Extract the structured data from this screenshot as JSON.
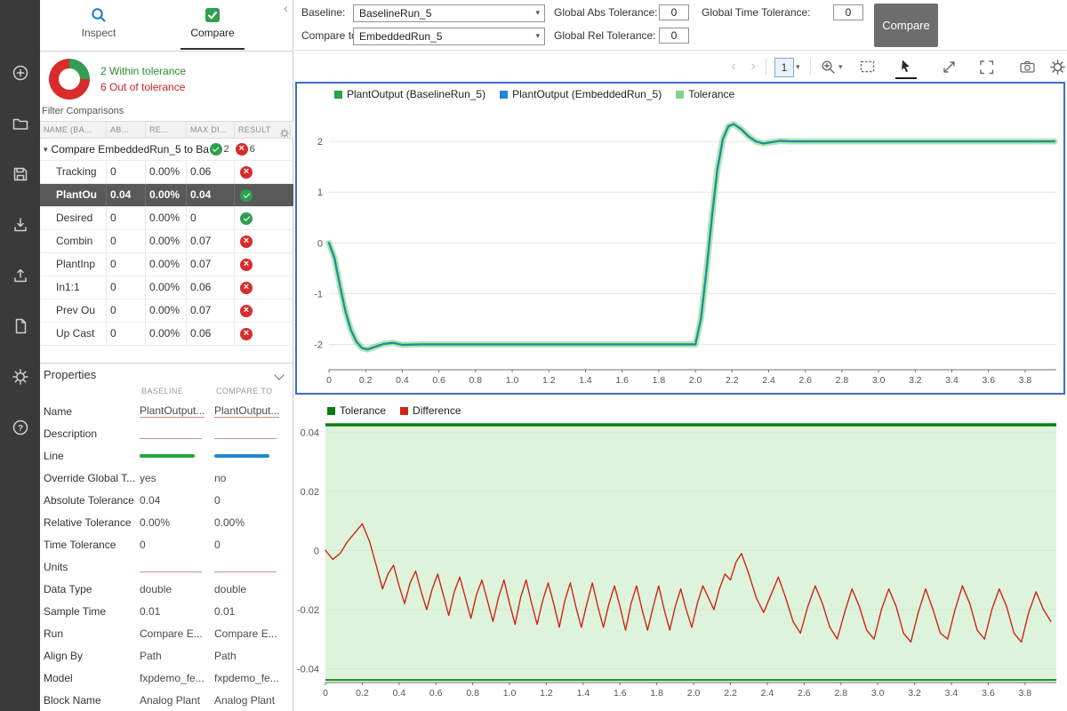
{
  "ui": {
    "tabs": {
      "inspect": "Inspect",
      "compare": "Compare"
    },
    "collapse_glyph": "‹"
  },
  "summary": {
    "within": "2 Within tolerance",
    "out": "6 Out of tolerance"
  },
  "filter_label": "Filter Comparisons",
  "rail_icons": [
    "add",
    "open",
    "save",
    "import",
    "export",
    "create-report",
    "preferences",
    "help"
  ],
  "toolbar2_icons": [
    "back",
    "forward",
    "subplot-layout",
    "zoom-in",
    "fit-to-view",
    "pointer",
    "expand",
    "fullscreen",
    "snapshot",
    "plot-settings"
  ],
  "comparisons": {
    "columns": [
      "NAME (BA...",
      "AB...",
      "RE...",
      "MAX DI...",
      "RESULT"
    ],
    "group": {
      "label": "Compare EmbeddedRun_5 to Ba...",
      "pass_count": "2",
      "fail_count": "6"
    },
    "rows": [
      {
        "name": "Tracking",
        "abs": "0",
        "rel": "0.00%",
        "max": "0.06",
        "result": "fail",
        "selected": false
      },
      {
        "name": "PlantOu",
        "abs": "0.04",
        "rel": "0.00%",
        "max": "0.04",
        "result": "pass",
        "selected": true
      },
      {
        "name": "Desired",
        "abs": "0",
        "rel": "0.00%",
        "max": "0",
        "result": "pass",
        "selected": false
      },
      {
        "name": "Combin",
        "abs": "0",
        "rel": "0.00%",
        "max": "0.07",
        "result": "fail",
        "selected": false
      },
      {
        "name": "PlantInp",
        "abs": "0",
        "rel": "0.00%",
        "max": "0.07",
        "result": "fail",
        "selected": false
      },
      {
        "name": "In1:1",
        "abs": "0",
        "rel": "0.00%",
        "max": "0.06",
        "result": "fail",
        "selected": false
      },
      {
        "name": "Prev Ou",
        "abs": "0",
        "rel": "0.00%",
        "max": "0.07",
        "result": "fail",
        "selected": false
      },
      {
        "name": "Up Cast",
        "abs": "0",
        "rel": "0.00%",
        "max": "0.06",
        "result": "fail",
        "selected": false
      }
    ]
  },
  "properties": {
    "title": "Properties",
    "columns": [
      "BASELINE",
      "COMPARE TO"
    ],
    "line_colors": {
      "baseline": "#27a244",
      "compare": "#1e88d2"
    },
    "rows": [
      {
        "label": "Name",
        "baseline": "PlantOutput...",
        "compare": "PlantOutput...",
        "type": "text",
        "editable": true
      },
      {
        "label": "Description",
        "baseline": "",
        "compare": "",
        "type": "text",
        "editable": true
      },
      {
        "label": "Line",
        "baseline": "",
        "compare": "",
        "type": "line",
        "editable": false
      },
      {
        "label": "Override Global T...",
        "baseline": "yes",
        "compare": "no",
        "type": "text",
        "editable": false
      },
      {
        "label": "Absolute Tolerance",
        "baseline": "0.04",
        "compare": "0",
        "type": "text",
        "editable": false
      },
      {
        "label": "Relative Tolerance",
        "baseline": "0.00%",
        "compare": "0.00%",
        "type": "text",
        "editable": false
      },
      {
        "label": "Time Tolerance",
        "baseline": "0",
        "compare": "0",
        "type": "text",
        "editable": false
      },
      {
        "label": "Units",
        "baseline": "",
        "compare": "",
        "type": "text",
        "editable": true
      },
      {
        "label": "Data Type",
        "baseline": "double",
        "compare": "double",
        "type": "text",
        "editable": false
      },
      {
        "label": "Sample Time",
        "baseline": "0.01",
        "compare": "0.01",
        "type": "text",
        "editable": false
      },
      {
        "label": "Run",
        "baseline": "Compare E...",
        "compare": "Compare E...",
        "type": "text",
        "editable": false
      },
      {
        "label": "Align By",
        "baseline": "Path",
        "compare": "Path",
        "type": "text",
        "editable": false
      },
      {
        "label": "Model",
        "baseline": "fxpdemo_fe...",
        "compare": "fxpdemo_fe...",
        "type": "text",
        "editable": false
      },
      {
        "label": "Block Name",
        "baseline": "Analog Plant",
        "compare": "Analog Plant",
        "type": "text",
        "editable": false
      }
    ]
  },
  "topbar": {
    "baseline_label": "Baseline:",
    "baseline_value": "BaselineRun_5",
    "compare_label": "Compare to:",
    "compare_value": "EmbeddedRun_5",
    "abs_label": "Global Abs Tolerance:",
    "abs_value": "0",
    "rel_label": "Global Rel Tolerance:",
    "rel_value": "0",
    "time_label": "Global Time Tolerance:",
    "time_value": "0",
    "compare_button": "Compare"
  },
  "toolbar": {
    "layout_value": "1"
  },
  "colors": {
    "selection_blue": "#3a6fc5",
    "pass_green": "#2e9e4f",
    "fail_red": "#d92b2b",
    "baseline_line": "#27a244",
    "compare_line": "#1e88d2",
    "tolerance_fill": "#c9ecc6",
    "tolerance_edge": "#0c7c10",
    "difference_line": "#cf2613"
  },
  "chart_data": [
    {
      "type": "line",
      "name": "signal-comparison",
      "title": "",
      "series": [
        {
          "name": "PlantOutput (BaselineRun_5)",
          "color": "#27a244"
        },
        {
          "name": "PlantOutput (EmbeddedRun_5)",
          "color": "#1e88d2"
        },
        {
          "name": "Tolerance",
          "color": "#7fd48c"
        }
      ],
      "xlim": [
        0,
        3.97
      ],
      "ylim": [
        -2.5,
        2.65
      ],
      "yticks": [
        2,
        1,
        0,
        -1,
        -2
      ],
      "ytick_labels": [
        "2",
        "1",
        "0",
        "-1",
        "-2"
      ],
      "xticks": [
        0,
        0.2,
        0.4,
        0.6,
        0.8,
        1.0,
        1.2,
        1.4,
        1.6,
        1.8,
        2.0,
        2.2,
        2.4,
        2.6,
        2.8,
        3.0,
        3.2,
        3.4,
        3.6,
        3.8
      ],
      "xtick_labels": [
        "0",
        "0.2",
        "0.4",
        "0.6",
        "0.8",
        "1.0",
        "1.2",
        "1.4",
        "1.6",
        "1.8",
        "2.0",
        "2.2",
        "2.4",
        "2.6",
        "2.8",
        "3.0",
        "3.2",
        "3.4",
        "3.6",
        "3.8"
      ],
      "tolerance_abs": 0.04,
      "points": {
        "signal": [
          [
            0,
            0
          ],
          [
            0.03,
            -0.3
          ],
          [
            0.06,
            -0.85
          ],
          [
            0.09,
            -1.35
          ],
          [
            0.12,
            -1.72
          ],
          [
            0.15,
            -1.95
          ],
          [
            0.18,
            -2.07
          ],
          [
            0.21,
            -2.1
          ],
          [
            0.25,
            -2.05
          ],
          [
            0.3,
            -1.99
          ],
          [
            0.35,
            -1.97
          ],
          [
            0.4,
            -2.01
          ],
          [
            0.5,
            -2.0
          ],
          [
            0.75,
            -2.0
          ],
          [
            1.0,
            -2.0
          ],
          [
            1.25,
            -2.0
          ],
          [
            1.5,
            -2.0
          ],
          [
            1.75,
            -2.0
          ],
          [
            2.0,
            -2.0
          ],
          [
            2.03,
            -1.5
          ],
          [
            2.06,
            -0.55
          ],
          [
            2.09,
            0.5
          ],
          [
            2.12,
            1.45
          ],
          [
            2.15,
            2.05
          ],
          [
            2.18,
            2.3
          ],
          [
            2.21,
            2.34
          ],
          [
            2.25,
            2.24
          ],
          [
            2.29,
            2.1
          ],
          [
            2.33,
            2.0
          ],
          [
            2.37,
            1.96
          ],
          [
            2.41,
            1.98
          ],
          [
            2.46,
            2.01
          ],
          [
            2.52,
            2.0
          ],
          [
            2.75,
            2.0
          ],
          [
            3.0,
            2.0
          ],
          [
            3.25,
            2.0
          ],
          [
            3.5,
            2.0
          ],
          [
            3.75,
            2.0
          ],
          [
            3.96,
            2.0
          ]
        ]
      },
      "render_lines": [
        {
          "src": "signal",
          "color": "#a5e2ab",
          "width": 7,
          "opacity": 0.85,
          "role": "tolerance-band"
        },
        {
          "src": "signal",
          "color": "#27a244",
          "width": 2.4,
          "opacity": 1,
          "role": "baseline"
        },
        {
          "src": "signal",
          "color": "#1e88d2",
          "width": 1.3,
          "opacity": 1,
          "role": "compare"
        }
      ]
    },
    {
      "type": "line",
      "name": "difference",
      "title": "",
      "series": [
        {
          "name": "Tolerance",
          "color": "#0c7c10"
        },
        {
          "name": "Difference",
          "color": "#cf2613"
        }
      ],
      "xlim": [
        0,
        3.97
      ],
      "ylim": [
        -0.0447,
        0.0437
      ],
      "yticks": [
        0.04,
        0.02,
        0,
        -0.02,
        -0.04
      ],
      "ytick_labels": [
        "0.04",
        "0.02",
        "0",
        "-0.02",
        "-0.04"
      ],
      "xticks": [
        0,
        0.2,
        0.4,
        0.6,
        0.8,
        1.0,
        1.2,
        1.4,
        1.6,
        1.8,
        2.0,
        2.2,
        2.4,
        2.6,
        2.8,
        3.0,
        3.2,
        3.4,
        3.6,
        3.8
      ],
      "xtick_labels": [
        "0",
        "0.2",
        "0.4",
        "0.6",
        "0.8",
        "1.0",
        "1.2",
        "1.4",
        "1.6",
        "1.8",
        "2.0",
        "2.2",
        "2.4",
        "2.6",
        "2.8",
        "3.0",
        "3.2",
        "3.4",
        "3.6",
        "3.8"
      ],
      "band": {
        "hi": 0.0425,
        "lo": -0.0438,
        "fill": "#c9ecc6",
        "edge": "#0c7c10"
      },
      "points": {
        "diff": [
          [
            0,
            0
          ],
          [
            0.04,
            -0.003
          ],
          [
            0.08,
            -0.001
          ],
          [
            0.12,
            0.003
          ],
          [
            0.16,
            0.006
          ],
          [
            0.2,
            0.009
          ],
          [
            0.24,
            0.003
          ],
          [
            0.28,
            -0.006
          ],
          [
            0.31,
            -0.013
          ],
          [
            0.34,
            -0.008
          ],
          [
            0.37,
            -0.005
          ],
          [
            0.4,
            -0.012
          ],
          [
            0.43,
            -0.018
          ],
          [
            0.46,
            -0.011
          ],
          [
            0.49,
            -0.007
          ],
          [
            0.52,
            -0.014
          ],
          [
            0.55,
            -0.02
          ],
          [
            0.58,
            -0.013
          ],
          [
            0.61,
            -0.008
          ],
          [
            0.64,
            -0.015
          ],
          [
            0.67,
            -0.022
          ],
          [
            0.7,
            -0.014
          ],
          [
            0.73,
            -0.009
          ],
          [
            0.76,
            -0.016
          ],
          [
            0.79,
            -0.023
          ],
          [
            0.82,
            -0.015
          ],
          [
            0.85,
            -0.01
          ],
          [
            0.88,
            -0.017
          ],
          [
            0.91,
            -0.024
          ],
          [
            0.94,
            -0.016
          ],
          [
            0.97,
            -0.01
          ],
          [
            1,
            -0.018
          ],
          [
            1.03,
            -0.025
          ],
          [
            1.06,
            -0.016
          ],
          [
            1.09,
            -0.01
          ],
          [
            1.12,
            -0.018
          ],
          [
            1.15,
            -0.025
          ],
          [
            1.18,
            -0.017
          ],
          [
            1.21,
            -0.011
          ],
          [
            1.24,
            -0.018
          ],
          [
            1.27,
            -0.026
          ],
          [
            1.3,
            -0.017
          ],
          [
            1.33,
            -0.011
          ],
          [
            1.36,
            -0.019
          ],
          [
            1.39,
            -0.026
          ],
          [
            1.42,
            -0.018
          ],
          [
            1.45,
            -0.011
          ],
          [
            1.48,
            -0.019
          ],
          [
            1.51,
            -0.026
          ],
          [
            1.54,
            -0.018
          ],
          [
            1.57,
            -0.012
          ],
          [
            1.6,
            -0.019
          ],
          [
            1.63,
            -0.027
          ],
          [
            1.66,
            -0.018
          ],
          [
            1.69,
            -0.012
          ],
          [
            1.72,
            -0.02
          ],
          [
            1.75,
            -0.027
          ],
          [
            1.78,
            -0.019
          ],
          [
            1.81,
            -0.012
          ],
          [
            1.84,
            -0.02
          ],
          [
            1.87,
            -0.027
          ],
          [
            1.9,
            -0.019
          ],
          [
            1.93,
            -0.013
          ],
          [
            1.96,
            -0.02
          ],
          [
            1.99,
            -0.026
          ],
          [
            2.02,
            -0.018
          ],
          [
            2.05,
            -0.012
          ],
          [
            2.08,
            -0.016
          ],
          [
            2.11,
            -0.02
          ],
          [
            2.14,
            -0.013
          ],
          [
            2.17,
            -0.008
          ],
          [
            2.2,
            -0.01
          ],
          [
            2.23,
            -0.004
          ],
          [
            2.26,
            -0.001
          ],
          [
            2.3,
            -0.008
          ],
          [
            2.34,
            -0.016
          ],
          [
            2.38,
            -0.021
          ],
          [
            2.42,
            -0.015
          ],
          [
            2.46,
            -0.009
          ],
          [
            2.5,
            -0.016
          ],
          [
            2.54,
            -0.024
          ],
          [
            2.58,
            -0.028
          ],
          [
            2.62,
            -0.019
          ],
          [
            2.66,
            -0.012
          ],
          [
            2.7,
            -0.018
          ],
          [
            2.74,
            -0.026
          ],
          [
            2.78,
            -0.03
          ],
          [
            2.82,
            -0.021
          ],
          [
            2.86,
            -0.013
          ],
          [
            2.9,
            -0.019
          ],
          [
            2.94,
            -0.027
          ],
          [
            2.98,
            -0.03
          ],
          [
            3.02,
            -0.02
          ],
          [
            3.06,
            -0.013
          ],
          [
            3.1,
            -0.019
          ],
          [
            3.14,
            -0.028
          ],
          [
            3.18,
            -0.031
          ],
          [
            3.22,
            -0.021
          ],
          [
            3.26,
            -0.013
          ],
          [
            3.3,
            -0.02
          ],
          [
            3.34,
            -0.028
          ],
          [
            3.38,
            -0.03
          ],
          [
            3.42,
            -0.02
          ],
          [
            3.46,
            -0.012
          ],
          [
            3.5,
            -0.018
          ],
          [
            3.54,
            -0.027
          ],
          [
            3.58,
            -0.03
          ],
          [
            3.62,
            -0.02
          ],
          [
            3.66,
            -0.013
          ],
          [
            3.7,
            -0.019
          ],
          [
            3.74,
            -0.028
          ],
          [
            3.78,
            -0.031
          ],
          [
            3.82,
            -0.021
          ],
          [
            3.86,
            -0.014
          ],
          [
            3.9,
            -0.02
          ],
          [
            3.94,
            -0.024
          ]
        ]
      },
      "render_lines": [
        {
          "src": "diff",
          "color": "#cf2613",
          "width": 1.4,
          "opacity": 1,
          "role": "difference"
        }
      ]
    }
  ]
}
